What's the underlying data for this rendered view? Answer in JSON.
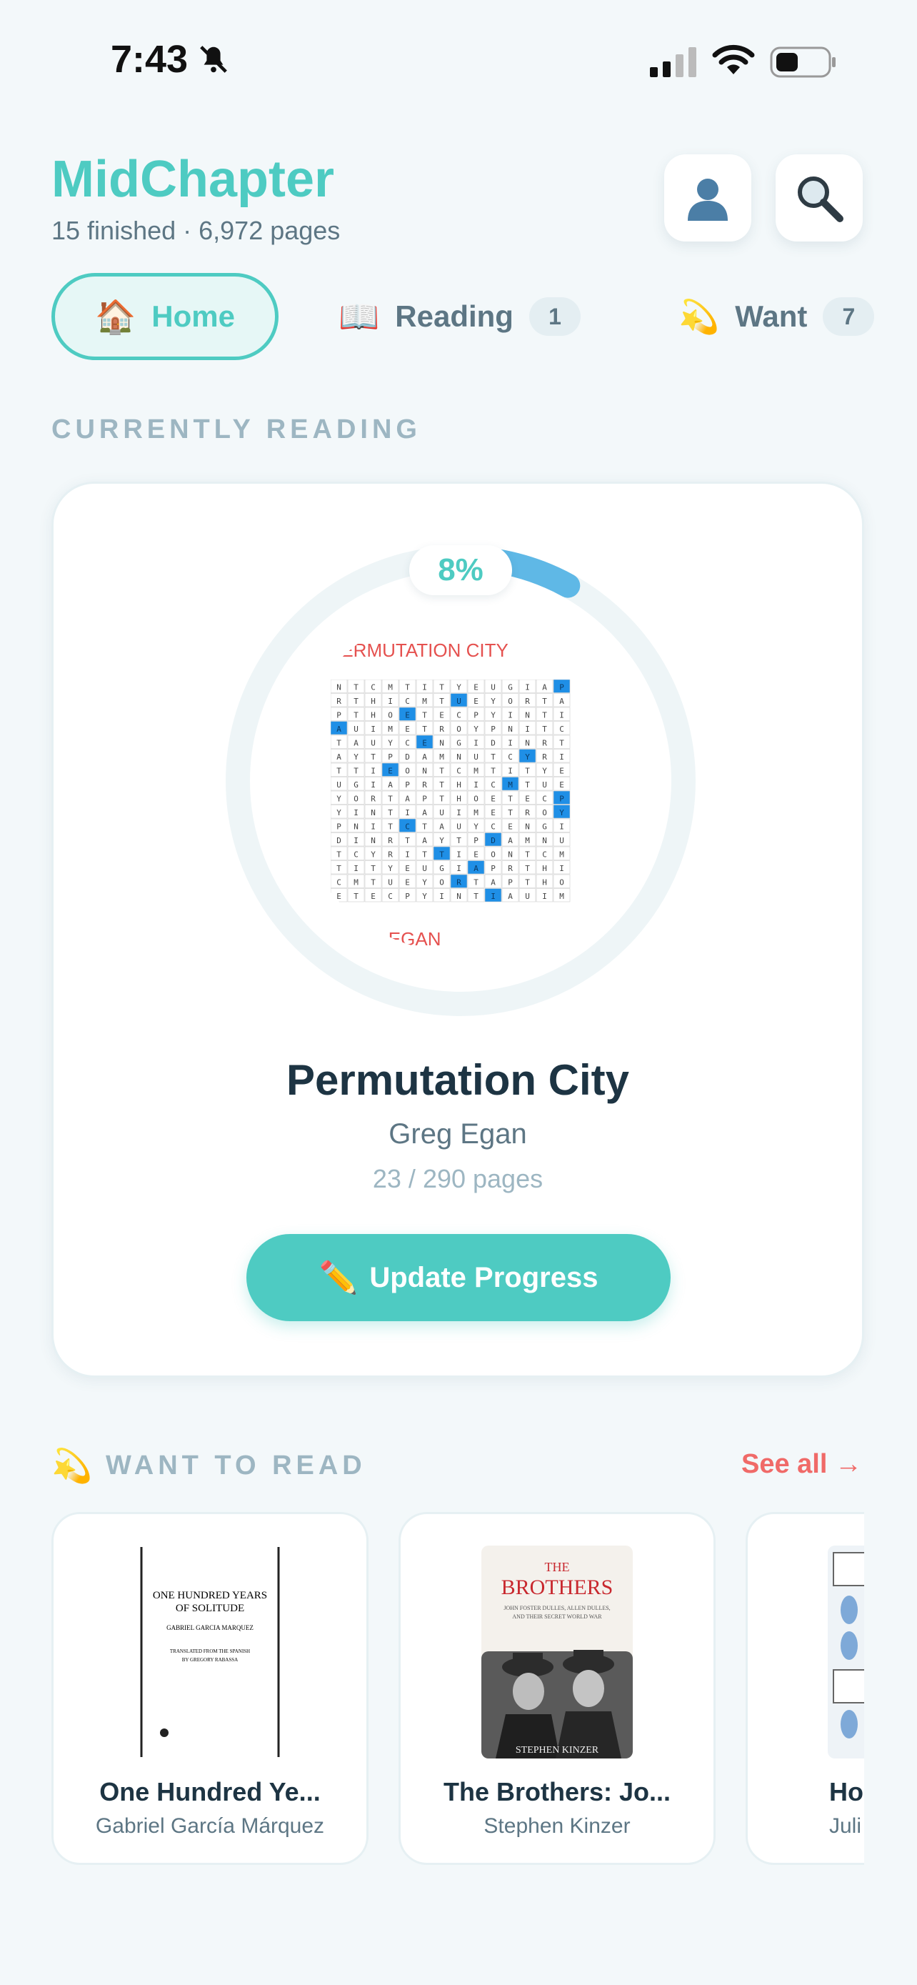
{
  "status_bar": {
    "time": "7:43"
  },
  "header": {
    "title": "MidChapter",
    "subtitle": "15 finished · 6,972 pages"
  },
  "tabs": [
    {
      "emoji": "🏠",
      "label": "Home"
    },
    {
      "emoji": "📖",
      "label": "Reading",
      "count": "1"
    },
    {
      "emoji": "💫",
      "label": "Want",
      "count": "7"
    }
  ],
  "current": {
    "section_label": "CURRENTLY READING",
    "percent_label": "8%",
    "progress_fraction": 0.08,
    "title": "Permutation City",
    "author": "Greg Egan",
    "pages": "23 / 290 pages",
    "cover_title": "PERMUTATION CITY",
    "cover_author": "GREG EGAN",
    "button_emoji": "✏️",
    "button_label": "Update Progress"
  },
  "want": {
    "emoji": "💫",
    "section_label": "WANT TO READ",
    "see_all": "See all →",
    "books": [
      {
        "title": "One Hundred Ye...",
        "author": "Gabriel García Márquez",
        "cover_lines": [
          "ONE HUNDRED YEARS",
          "OF SOLITUDE",
          "GABRIEL GARCIA MARQUEZ",
          "TRANSLATED FROM THE SPANISH",
          "BY GREGORY RABASSA"
        ]
      },
      {
        "title": "The Brothers: Jo...",
        "author": "Stephen Kinzer",
        "cover_lines": [
          "THE",
          "BROTHERS",
          "JOHN FOSTER DULLES, ALLEN DULLES,",
          "AND THEIR SECRET WORLD WAR",
          "STEPHEN KINZER"
        ]
      },
      {
        "title": "Ho",
        "author": "Juli"
      }
    ]
  },
  "colors": {
    "accent": "#4ecbc2",
    "progress": "#5fb8e6",
    "link": "#f06a68"
  }
}
